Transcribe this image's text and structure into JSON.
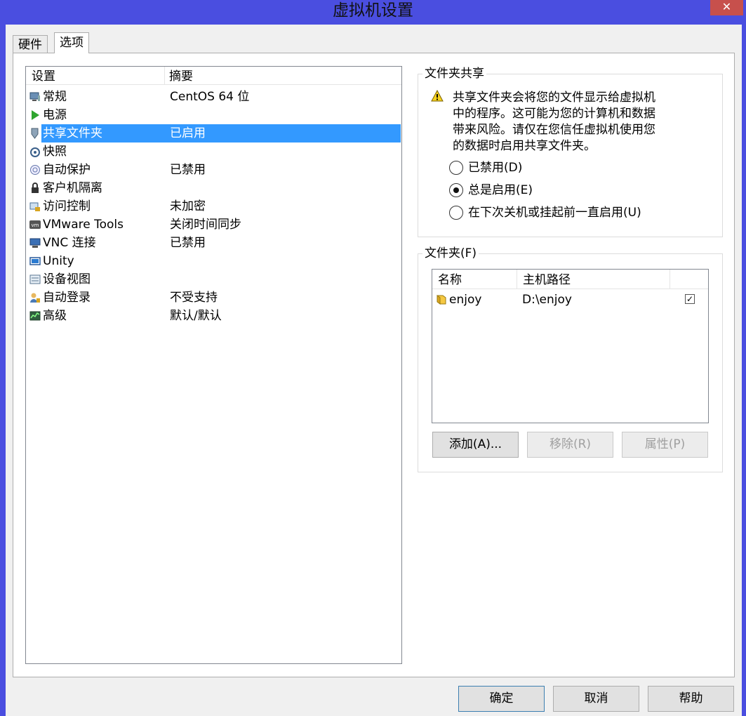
{
  "window": {
    "title": "虚拟机设置",
    "close_symbol": "✕"
  },
  "tabs": [
    {
      "label": "硬件"
    },
    {
      "label": "选项"
    }
  ],
  "settings_list": {
    "col_setting": "设置",
    "col_summary": "摘要",
    "items": [
      {
        "name": "常规",
        "summary": "CentOS 64 位",
        "icon": "monitor-icon"
      },
      {
        "name": "电源",
        "summary": "",
        "icon": "play-icon"
      },
      {
        "name": "共享文件夹",
        "summary": "已启用",
        "icon": "shield-folder-icon",
        "selected": true
      },
      {
        "name": "快照",
        "summary": "",
        "icon": "snapshot-icon"
      },
      {
        "name": "自动保护",
        "summary": "已禁用",
        "icon": "autoprotect-icon"
      },
      {
        "name": "客户机隔离",
        "summary": "",
        "icon": "lock-icon"
      },
      {
        "name": "访问控制",
        "summary": "未加密",
        "icon": "access-control-icon"
      },
      {
        "name": "VMware Tools",
        "summary": "关闭时间同步",
        "icon": "vm-icon"
      },
      {
        "name": "VNC 连接",
        "summary": "已禁用",
        "icon": "vnc-icon"
      },
      {
        "name": "Unity",
        "summary": "",
        "icon": "unity-icon"
      },
      {
        "name": "设备视图",
        "summary": "",
        "icon": "device-view-icon"
      },
      {
        "name": "自动登录",
        "summary": "不受支持",
        "icon": "user-icon"
      },
      {
        "name": "高级",
        "summary": "默认/默认",
        "icon": "advanced-icon"
      }
    ]
  },
  "sharing": {
    "legend": "文件夹共享",
    "warning_lines": [
      "共享文件夹会将您的文件显示给虚拟机",
      "中的程序。这可能为您的计算机和数据",
      "带来风险。请仅在您信任虚拟机使用您",
      "的数据时启用共享文件夹。"
    ],
    "options": [
      {
        "label": "已禁用(D)",
        "checked": false
      },
      {
        "label": "总是启用(E)",
        "checked": true
      },
      {
        "label": "在下次关机或挂起前一直启用(U)",
        "checked": false
      }
    ]
  },
  "folders": {
    "legend": "文件夹(F)",
    "col_name": "名称",
    "col_path": "主机路径",
    "rows": [
      {
        "name": "enjoy",
        "path": "D:\\enjoy",
        "checked": true,
        "check_symbol": "✓"
      }
    ],
    "add_label": "添加(A)...",
    "remove_label": "移除(R)",
    "props_label": "属性(P)"
  },
  "footer": {
    "ok_label": "确定",
    "cancel_label": "取消",
    "help_label": "帮助"
  }
}
